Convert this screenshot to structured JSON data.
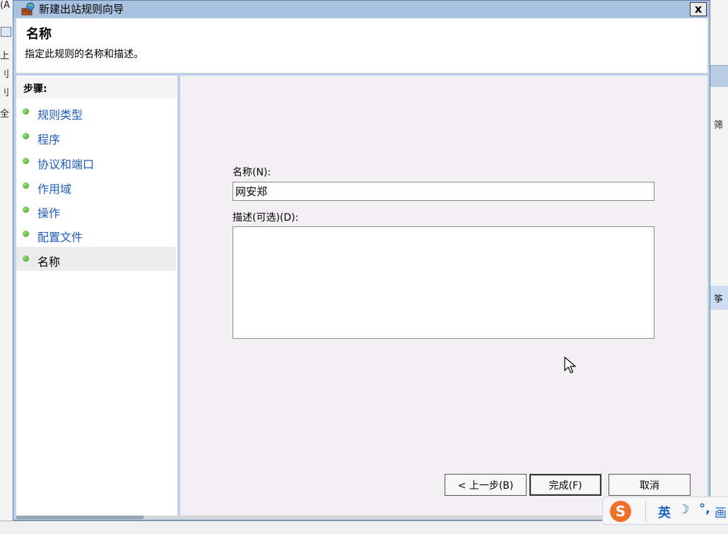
{
  "background": {
    "left_fragments": [
      "(A",
      "上",
      "刂",
      "刂",
      "全"
    ],
    "right_fragments": [
      "筛",
      "筝"
    ]
  },
  "window": {
    "title": "新建出站规则向导",
    "close_label": "x",
    "icon": "firewall-wizard-icon"
  },
  "header": {
    "title": "名称",
    "subtitle": "指定此规则的名称和描述。"
  },
  "steps": {
    "title": "步骤:",
    "items": [
      {
        "label": "规则类型"
      },
      {
        "label": "程序"
      },
      {
        "label": "协议和端口"
      },
      {
        "label": "作用域"
      },
      {
        "label": "操作"
      },
      {
        "label": "配置文件"
      },
      {
        "label": "名称"
      }
    ],
    "current_index": 6,
    "dot_color": "#3d9a1e",
    "link_color": "#1f5bbf"
  },
  "form": {
    "name_label": "名称(N):",
    "name_value": "网安郑",
    "description_label": "描述(可选)(D):",
    "description_value": ""
  },
  "buttons": {
    "back": "< 上一步(B)",
    "finish": "完成(F)",
    "cancel": "取消"
  },
  "ime": {
    "logo": "S",
    "mode": "英",
    "moon": "☽",
    "punct": "°,",
    "more": "画"
  }
}
